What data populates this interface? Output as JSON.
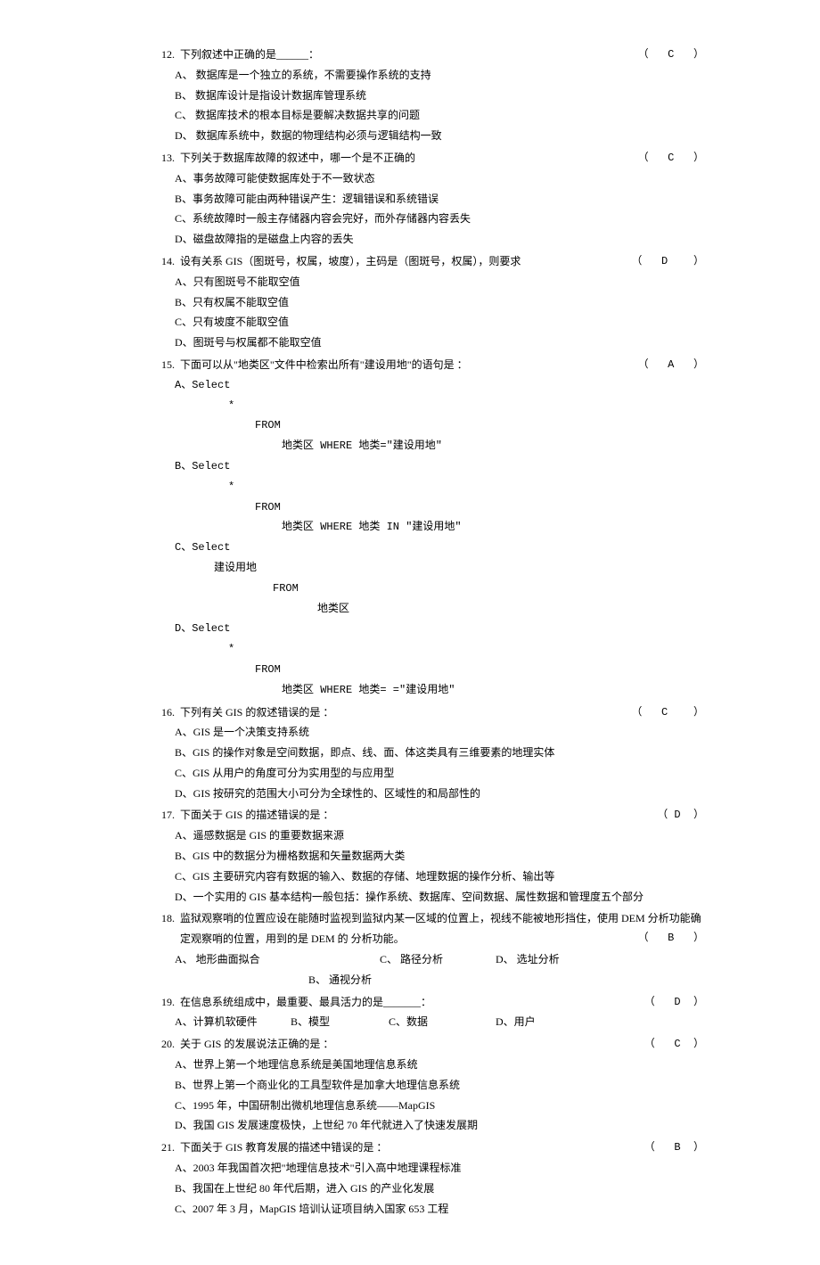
{
  "questions": [
    {
      "num": "12.",
      "stem": "下列叙述中正确的是______：",
      "answer": "（   C   ）",
      "options": [
        "A、  数据库是一个独立的系统，不需要操作系统的支持",
        "B、  数据库设计是指设计数据库管理系统",
        "C、  数据库技术的根本目标是要解决数据共享的问题",
        "D、  数据库系统中，数据的物理结构必须与逻辑结构一致"
      ]
    },
    {
      "num": "13.",
      "stem": "下列关于数据库故障的叙述中，哪一个是不正确的",
      "answer": "（   C   ）",
      "options": [
        "A、事务故障可能使数据库处于不一致状态",
        "B、事务故障可能由两种错误产生：逻辑错误和系统错误",
        "C、系统故障时一般主存储器内容会完好，而外存储器内容丢失",
        "D、磁盘故障指的是磁盘上内容的丢失"
      ]
    },
    {
      "num": "14.",
      "stem": "设有关系 GIS（图斑号，权属，坡度），主码是（图斑号，权属），则要求",
      "answer": "（   D    ）",
      "options": [
        "A、只有图斑号不能取空值",
        "B、只有权属不能取空值",
        "C、只有坡度不能取空值",
        "D、图斑号与权属都不能取空值"
      ]
    },
    {
      "num": "15.",
      "stem": "下面可以从\"地类区\"文件中检索出所有\"建设用地\"的语句是           ：",
      "answer": "（   A   ）",
      "sql_options": [
        {
          "label": "A、Select",
          "l1": "*",
          "l2": "FROM",
          "l3": "地类区 WHERE 地类=\"建设用地\""
        },
        {
          "label": "B、Select",
          "l1": "*",
          "l2": "FROM",
          "l3": "地类区 WHERE 地类 IN \"建设用地\""
        },
        {
          "label": "C、Select",
          "l1": "建设用地",
          "l2": "FROM",
          "l3": "地类区"
        },
        {
          "label": "D、Select",
          "l1": "*",
          "l2": "FROM",
          "l3": "地类区 WHERE 地类= =\"建设用地\""
        }
      ]
    },
    {
      "num": "16.",
      "stem": "下列有关 GIS 的叙述错误的是         ：",
      "answer": "（   C    ）",
      "options": [
        "A、GIS 是一个决策支持系统",
        "B、GIS 的操作对象是空间数据，即点、线、面、体这类具有三维要素的地理实体",
        "C、GIS 从用户的角度可分为实用型的与应用型",
        "D、GIS 按研究的范围大小可分为全球性的、区域性的和局部性的"
      ]
    },
    {
      "num": "17.",
      "stem": "下面关于 GIS 的描述错误的是         ：",
      "answer": "（ D  ）",
      "options": [
        "A、遥感数据是 GIS 的重要数据来源",
        "B、GIS 中的数据分为栅格数据和矢量数据两大类",
        "C、GIS 主要研究内容有数据的输入、数据的存储、地理数据的操作分析、输出等",
        "D、一个实用的 GIS 基本结构一般包括：操作系统、数据库、空间数据、属性数据和管理度五个部分"
      ]
    },
    {
      "num": "18.",
      "stem": "监狱观察哨的位置应设在能随时监视到监狱内某一区域的位置上，视线不能被地形挡住，使用 DEM 分析功能确定观察哨的位置，用到的是 DEM 的        分析功能。",
      "answer": "（   B   ）",
      "inline_options": {
        "a": "A、 地形曲面拟合",
        "b": "B、 通视分析",
        "c": "C、 路径分析",
        "d": "D、 选址分析"
      }
    },
    {
      "num": "19.",
      "stem": "在信息系统组成中，最重要、最具活力的是_______：",
      "answer": "（   D  ）",
      "inline_options": {
        "a": "A、计算机软硬件",
        "b": "B、模型",
        "c": "C、数据",
        "d": "D、用户"
      }
    },
    {
      "num": "20.",
      "stem": "关于 GIS 的发展说法正确的是         ：",
      "answer": "（   C  ）",
      "options": [
        "A、世界上第一个地理信息系统是美国地理信息系统",
        "B、世界上第一个商业化的工具型软件是加拿大地理信息系统",
        "C、1995 年，中国研制出微机地理信息系统——MapGIS",
        "D、我国 GIS 发展速度极快，上世纪 70 年代就进入了快速发展期"
      ]
    },
    {
      "num": "21.",
      "stem": "下面关于 GIS 教育发展的描述中错误的是           ：",
      "answer": "（   B  ）",
      "options": [
        "A、2003 年我国首次把\"地理信息技术\"引入高中地理课程标准",
        "B、我国在上世纪 80 年代后期，进入 GIS 的产业化发展",
        "C、2007 年 3 月，MapGIS 培训认证项目纳入国家 653 工程"
      ]
    }
  ]
}
